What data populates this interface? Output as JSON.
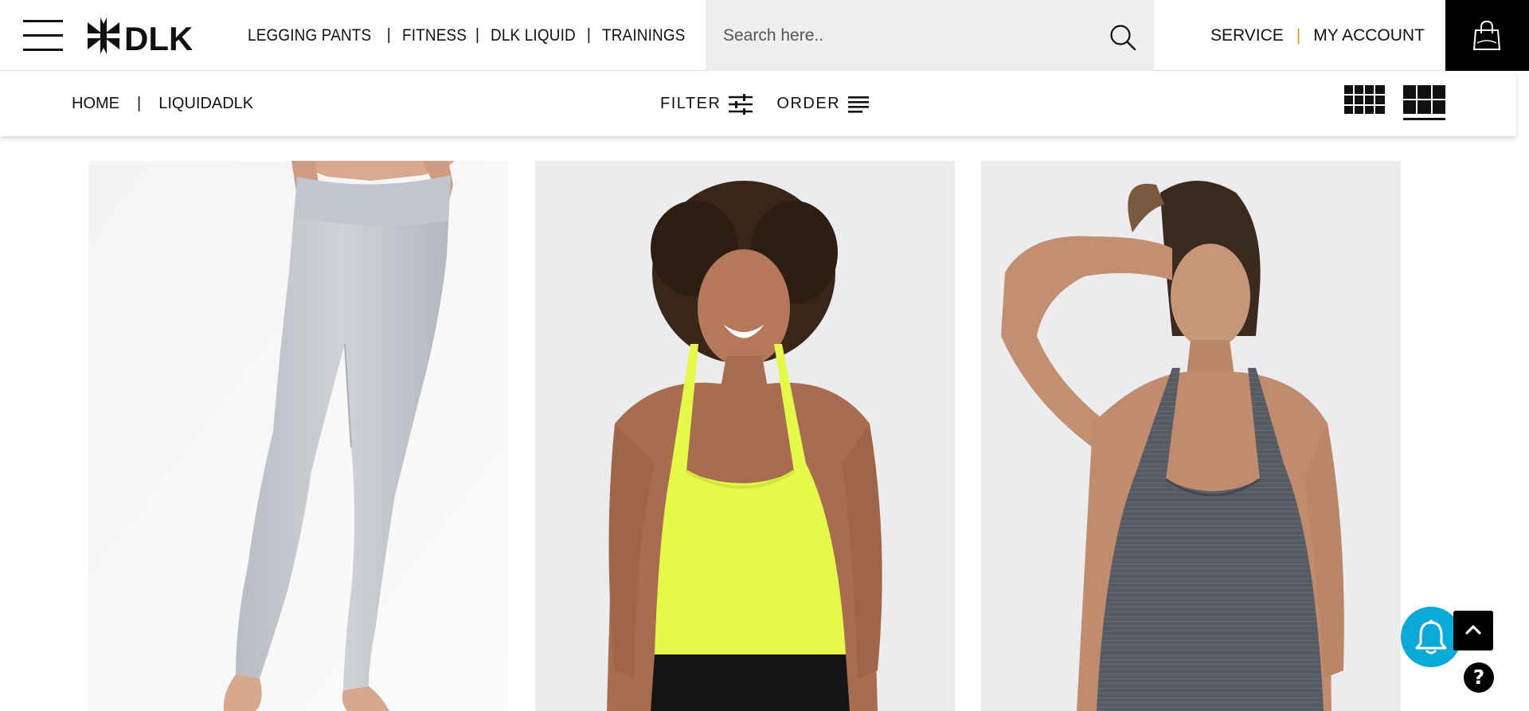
{
  "header": {
    "logo_text": "DLK",
    "nav": [
      {
        "label": "LEGGING PANTS"
      },
      {
        "label": "FITNESS"
      },
      {
        "label": "DLK LIQUID"
      },
      {
        "label": "TRAININGS"
      }
    ],
    "nav_separator": "|",
    "search": {
      "placeholder": "Search here..",
      "value": ""
    },
    "account_links": {
      "service": "SERVICE",
      "separator": "|",
      "account": "MY ACCOUNT"
    }
  },
  "subbar": {
    "breadcrumb": {
      "home": "HOME",
      "separator": "|",
      "current": "LIQUIDADLK"
    },
    "filter_label": "FILTER",
    "order_label": "ORDER"
  },
  "products": [
    {
      "image": "gray-legging-pants"
    },
    {
      "image": "neon-yellow-tank-top"
    },
    {
      "image": "charcoal-gray-tank-top"
    }
  ],
  "widgets": {
    "help_label": "?"
  },
  "colors": {
    "accent_separator": "#d79a2a",
    "notify_button": "#0aa9d8",
    "cart_background": "#000000",
    "search_background": "#efefef"
  },
  "icons": [
    "menu-icon",
    "search-icon",
    "shopping-bag-icon",
    "filter-sliders-icon",
    "order-lines-icon",
    "grid-4-icon",
    "grid-3-icon",
    "bell-icon",
    "chevron-up-icon",
    "help-icon"
  ]
}
